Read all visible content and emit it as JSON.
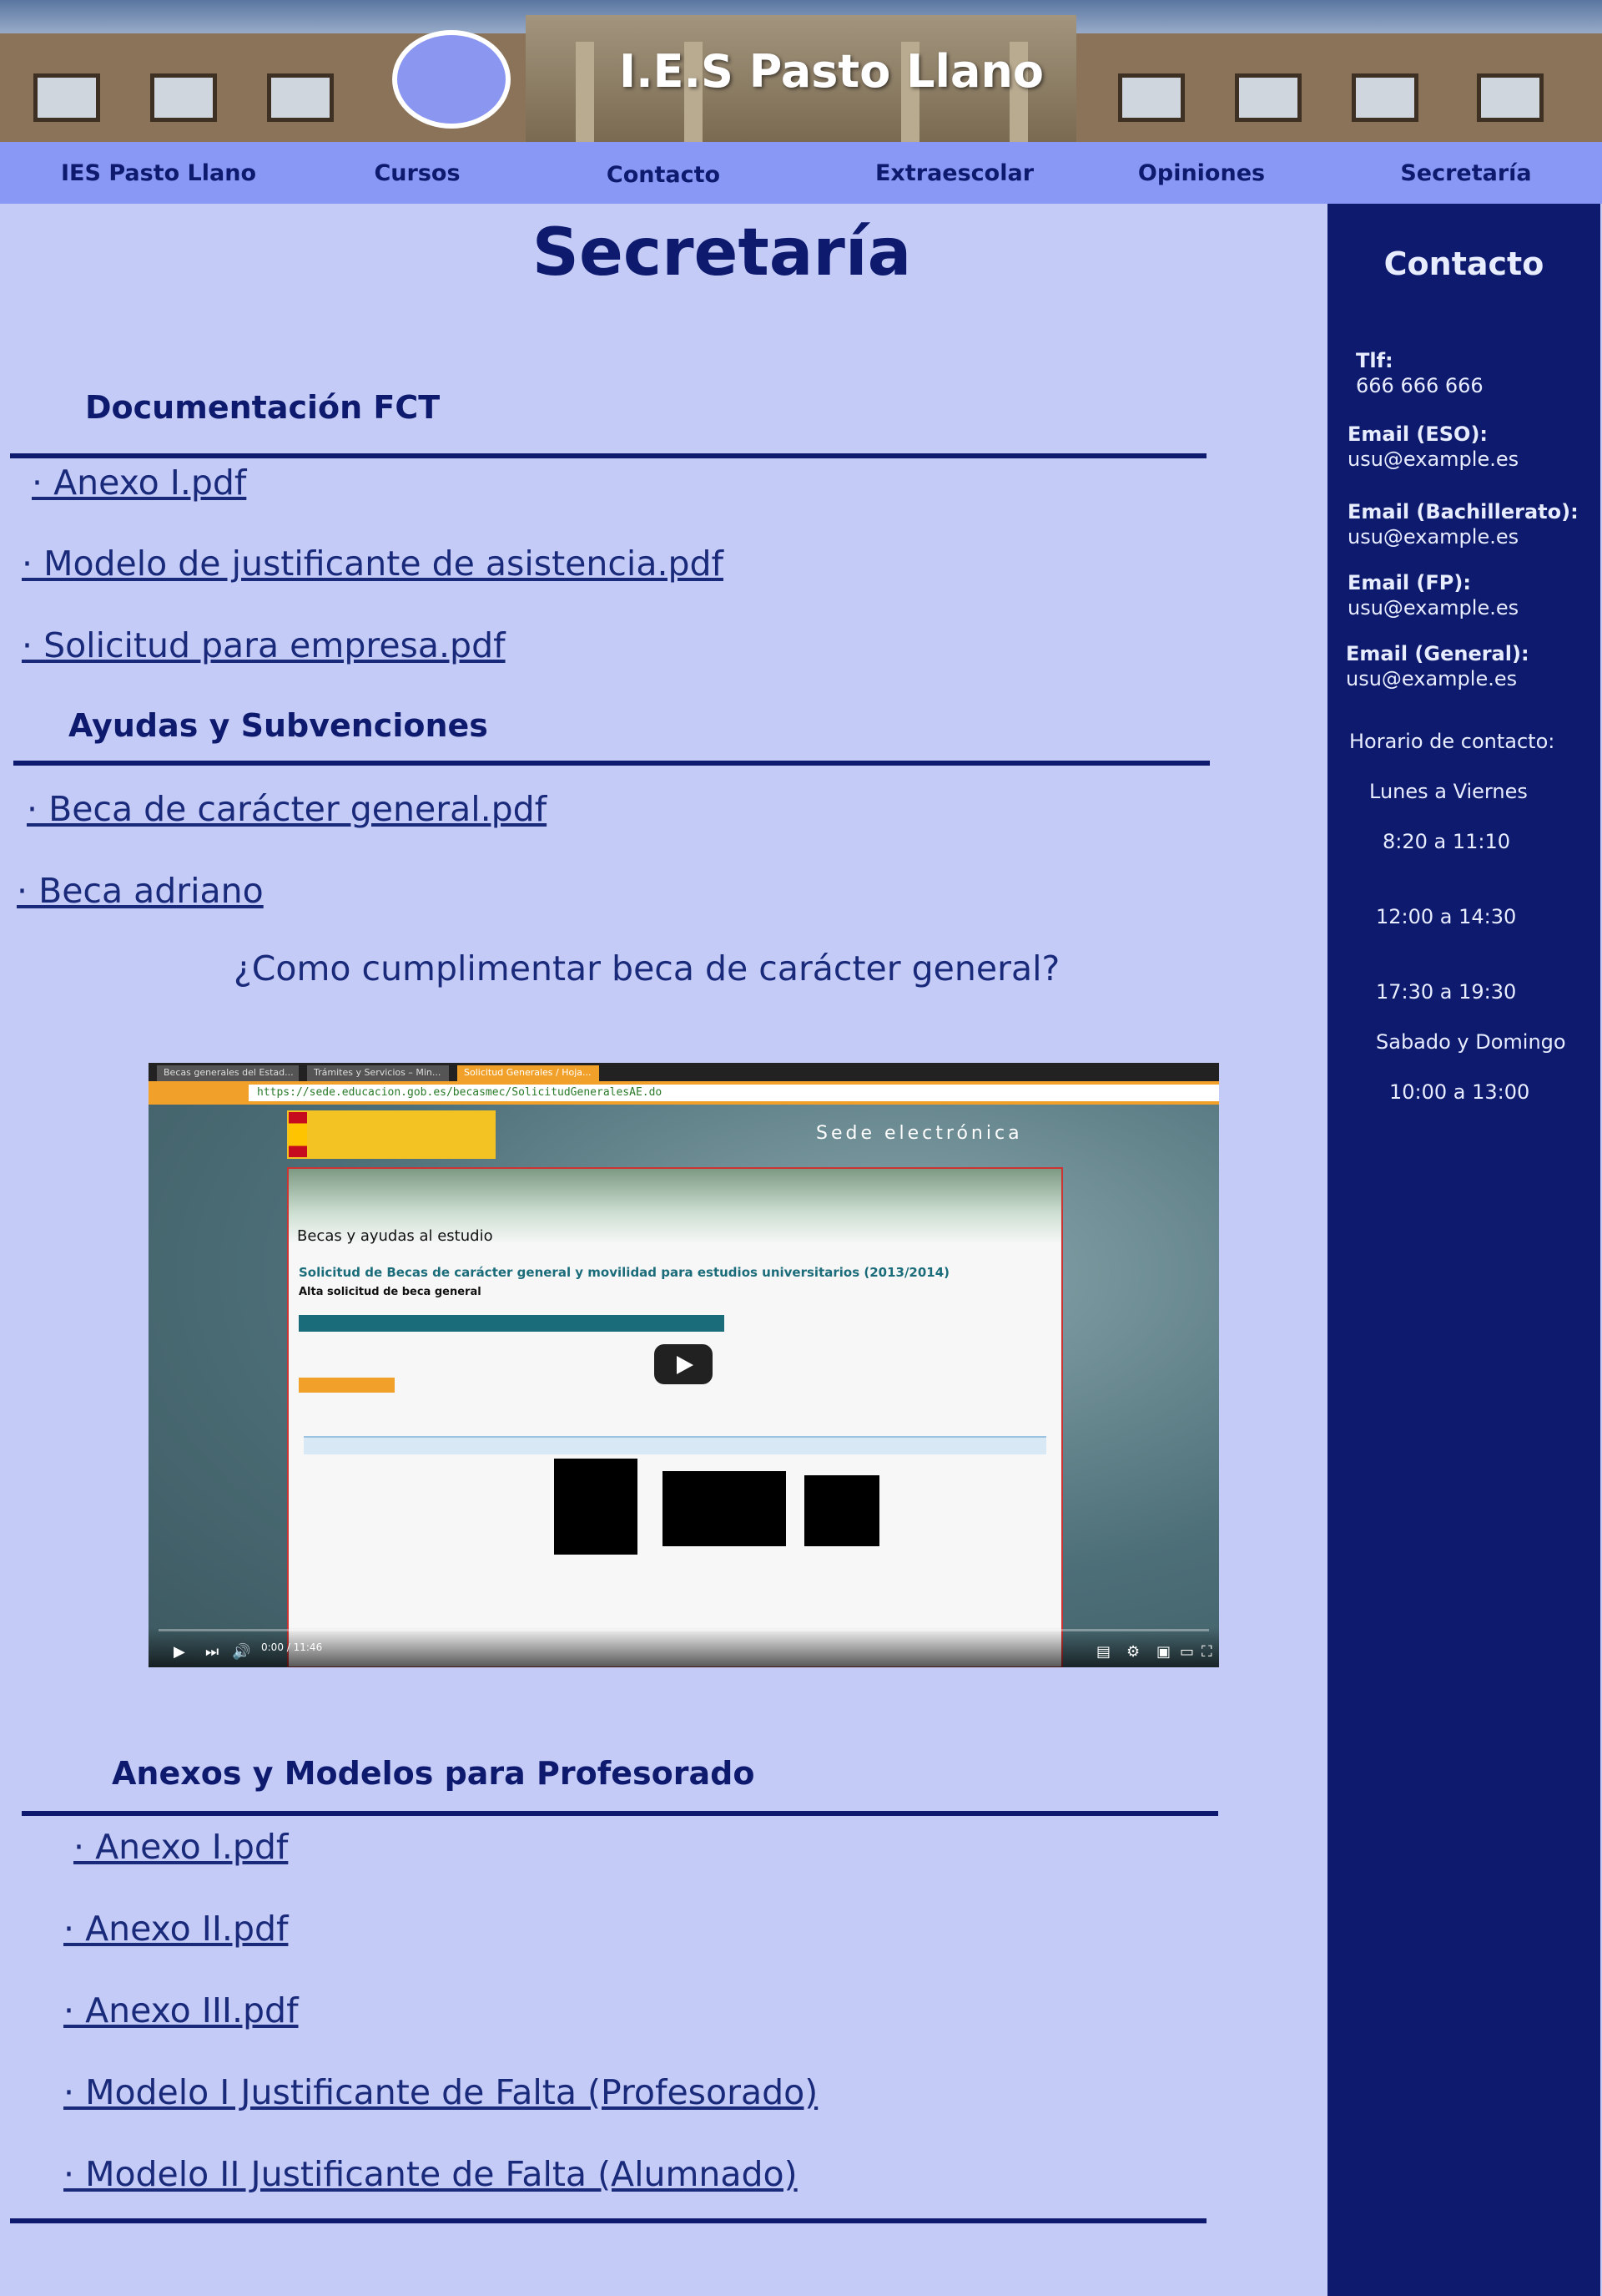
{
  "header": {
    "site_title": "I.E.S Pasto Llano"
  },
  "nav": {
    "items": [
      {
        "label": "IES Pasto Llano"
      },
      {
        "label": "Cursos"
      },
      {
        "label": "Contacto"
      },
      {
        "label": "Extraescolar"
      },
      {
        "label": "Opiniones"
      },
      {
        "label": "Secretaría"
      }
    ]
  },
  "main": {
    "title": "Secretaría",
    "sections": [
      {
        "heading": "Documentación FCT",
        "links": [
          "· Anexo I.pdf",
          "· Modelo de justificante de asistencia.pdf",
          "· Solicitud para empresa.pdf"
        ]
      },
      {
        "heading": "Ayudas y Subvenciones",
        "links": [
          "· Beca de carácter general.pdf",
          "·  Beca adriano"
        ]
      },
      {
        "heading": "Anexos y Modelos para Profesorado",
        "links": [
          "· Anexo I.pdf",
          "· Anexo II.pdf",
          "· Anexo III.pdf",
          "· Modelo I Justificante de Falta (Profesorado)",
          "· Modelo II Justificante de Falta (Alumnado)"
        ]
      }
    ],
    "video_question": "¿Como cumplimentar beca de carácter general?"
  },
  "video": {
    "tabs": [
      "Becas generales del Estad...",
      "Trámites y Servicios – Min...",
      "Solicitud Generales / Hoja..."
    ],
    "url": "https://sede.educacion.gob.es/becasmec/SolicitudGeneralesAE.do",
    "site_banner": "Sede electrónica",
    "page_heading": "Becas y ayudas al estudio",
    "form_title": "Solicitud de Becas de carácter general y movilidad para estudios universitarios  (2013/2014)",
    "form_subtitle": "Alta solicitud de beca general",
    "time": "0:00 / 11:46"
  },
  "sidebar": {
    "title": "Contacto",
    "phone_label": "Tlf:",
    "phone_value": "666 666 666",
    "emails": [
      {
        "label": "Email (ESO):",
        "value": "usu@example.es"
      },
      {
        "label": "Email (Bachillerato):",
        "value": "usu@example.es"
      },
      {
        "label": "Email (FP):",
        "value": "usu@example.es"
      },
      {
        "label": "Email (General):",
        "value": "usu@example.es"
      }
    ],
    "hours_title": "Horario de contacto:",
    "weekdays_label": "Lunes a Viernes",
    "weekday_slots": [
      "8:20 a 11:10",
      "12:00 a 14:30",
      "17:30 a 19:30"
    ],
    "weekend_label": "Sabado y Domingo",
    "weekend_slot": "10:00 a 13:00"
  },
  "colors": {
    "page_bg": "#c5cbf7",
    "nav_bg": "#8a98f5",
    "dark_blue": "#0d1a6e",
    "logo_circle": "#8a96f0"
  }
}
